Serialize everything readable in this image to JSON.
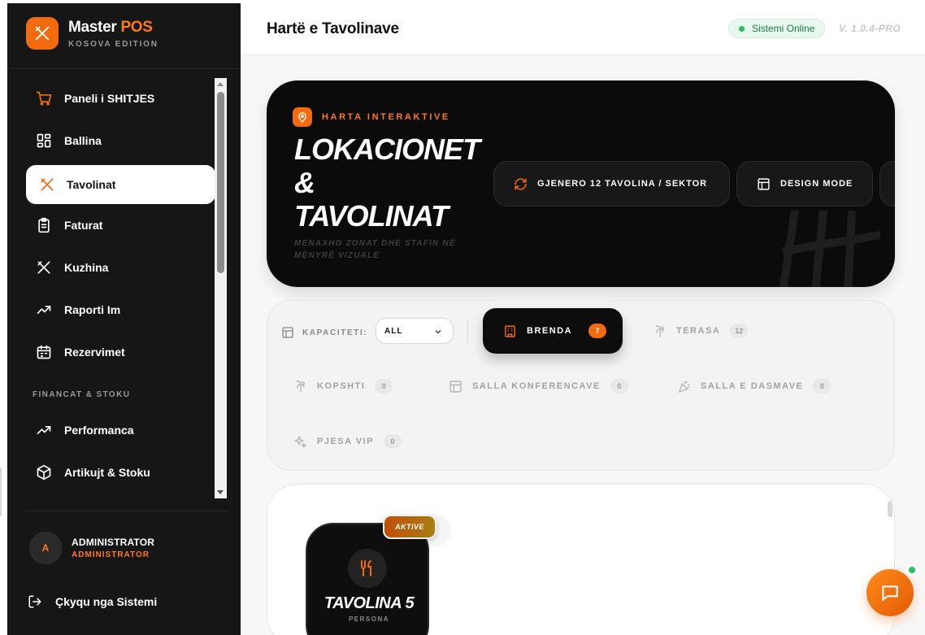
{
  "brand": {
    "name_main": "Master",
    "name_accent": "POS",
    "edition": "KOSOVA EDITION"
  },
  "sidebar": {
    "items": [
      {
        "label": "Paneli i SHITJES",
        "icon": "cart-icon"
      },
      {
        "label": "Ballina",
        "icon": "grid-icon"
      },
      {
        "label": "Tavolinat",
        "icon": "utensils-icon",
        "active": true
      },
      {
        "label": "Faturat",
        "icon": "clipboard-icon"
      },
      {
        "label": "Kuzhina",
        "icon": "utensils-icon"
      },
      {
        "label": "Raporti Im",
        "icon": "trend-up-icon"
      },
      {
        "label": "Rezervimet",
        "icon": "calendar-icon"
      }
    ],
    "section_label": "FINANCAT & STOKU",
    "section_items": [
      {
        "label": "Performanca",
        "icon": "trend-up-icon"
      },
      {
        "label": "Artikujt & Stoku",
        "icon": "box-icon"
      }
    ]
  },
  "user": {
    "initial": "A",
    "name": "ADMINISTRATOR",
    "role": "ADMINISTRATOR"
  },
  "logout": {
    "label": "Çkyqu nga Sistemi"
  },
  "header": {
    "title": "Hartë e Tavolinave",
    "status": "Sistemi Online",
    "version": "V. 1.0.4-PRO"
  },
  "hero": {
    "tag": "HARTA INTERAKTIVE",
    "title_line1": "LOKACIONET",
    "title_line2": "&",
    "title_line3": "TAVOLINAT",
    "subtitle": "MENAXHO ZONAT DHE STAFIN NË MËNYRË VIZUALE",
    "generate_button": "GJENERO 12 TAVOLINA / SEKTOR",
    "design_button": "DESIGN MODE"
  },
  "filters": {
    "capacity_label": "KAPACITETI:",
    "capacity_value": "ALL",
    "zones": [
      {
        "label": "BRENDA",
        "count": "7",
        "active": true,
        "icon": "building-icon"
      },
      {
        "label": "TERASA",
        "count": "12",
        "icon": "palm-icon"
      },
      {
        "label": "KOPSHTI",
        "count": "0",
        "icon": "palm-icon"
      },
      {
        "label": "SALLA KONFERENCAVE",
        "count": "0",
        "icon": "layout-icon"
      },
      {
        "label": "SALLA E DASMAVE",
        "count": "0",
        "icon": "party-icon"
      },
      {
        "label": "PJESA VIP",
        "count": "0",
        "icon": "sparkles-icon"
      }
    ]
  },
  "tables": [
    {
      "name": "TAVOLINA 5",
      "subtitle": "PERSONA",
      "badge": "AKTIVE",
      "icon": "fork-knife-icon"
    }
  ],
  "colors": {
    "accent": "#f26b0f",
    "sidebar": "#161616",
    "online": "#22c55e"
  }
}
